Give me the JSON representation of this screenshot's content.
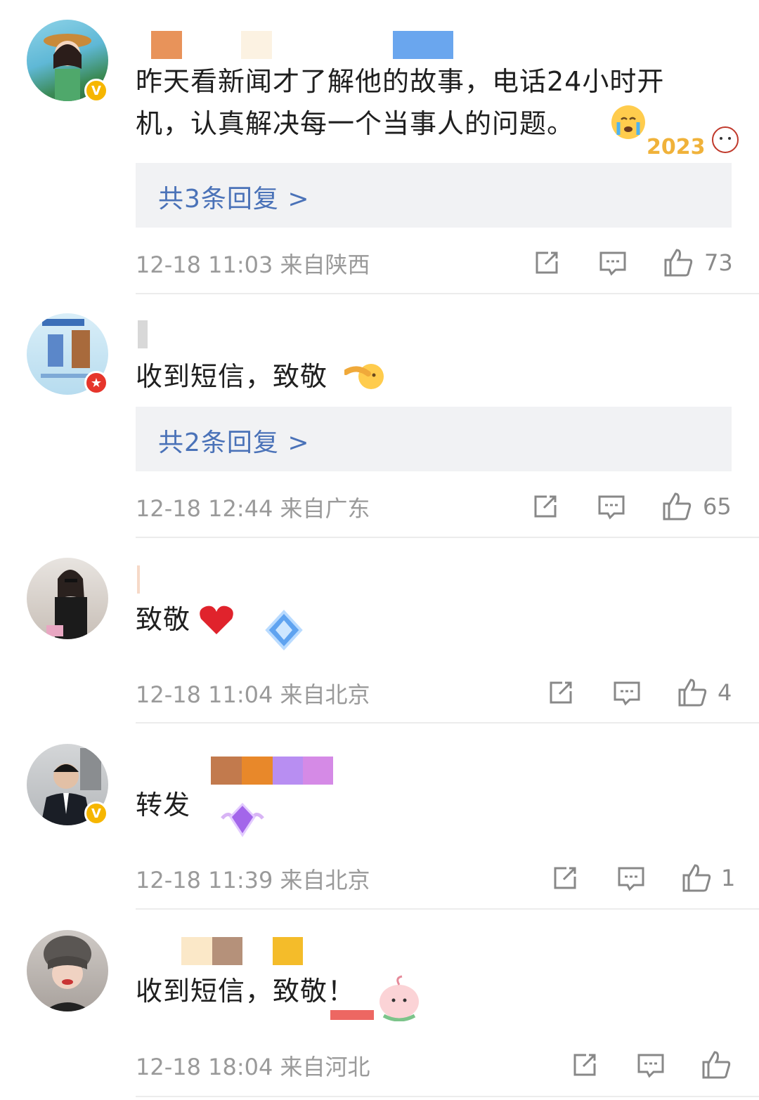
{
  "comments": [
    {
      "text": "昨天看新闻才了解他的故事，电话24小时开机，认真解决每一个当事人的问题。",
      "replies_label": "共3条回复 >",
      "meta": "12-18 11:03 来自陕西",
      "likes": "73",
      "badge": "V"
    },
    {
      "text": "收到短信，致敬",
      "replies_label": "共2条回复 >",
      "meta": "12-18 12:44 来自广东",
      "likes": "65",
      "badge": "★"
    },
    {
      "text": "致敬",
      "meta": "12-18 11:04 来自北京",
      "likes": "4"
    },
    {
      "text": "转发",
      "meta": "12-18 11:39 来自北京",
      "likes": "1",
      "badge": "V"
    },
    {
      "text": "收到短信，致敬！",
      "meta": "12-18 18:04 来自河北",
      "likes": ""
    }
  ],
  "icons": {
    "share": "share-icon",
    "comment": "comment-icon",
    "like": "thumbs-up-icon"
  },
  "colors": {
    "reply_link": "#4a72b8",
    "meta_text": "#9a9a9a",
    "reply_bg": "#f1f2f4",
    "verified_badge": "#f6b600",
    "red_badge": "#e6352b"
  }
}
